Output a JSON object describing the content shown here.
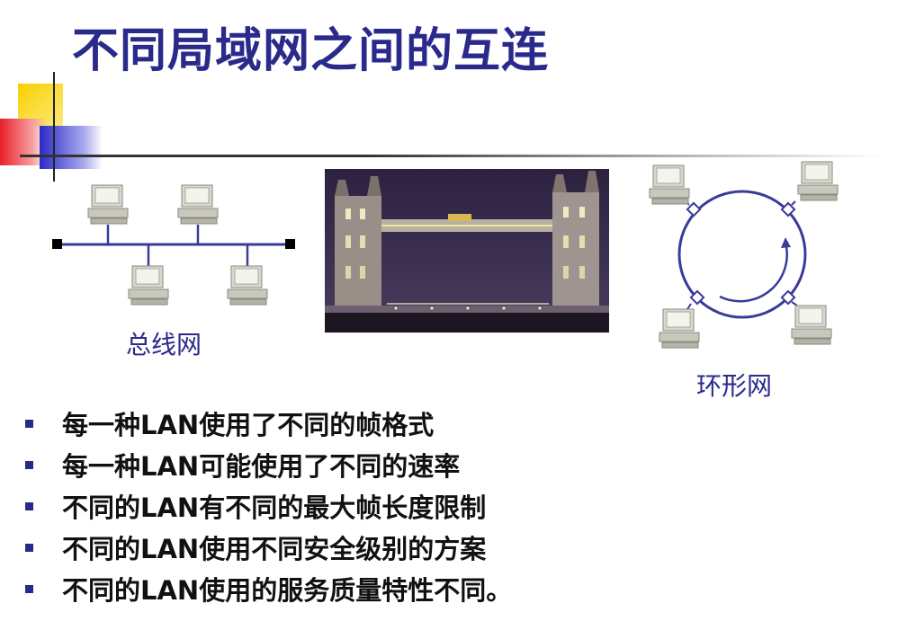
{
  "slide": {
    "title": "不同局域网之间的互连"
  },
  "diagrams": {
    "bus": {
      "label": "总线网",
      "computers": 4
    },
    "ring": {
      "label": "环形网",
      "computers": 4
    },
    "photo": {
      "subject": "tower-bridge-night-photo"
    }
  },
  "bullets": [
    "每一种LAN使用了不同的帧格式",
    "每一种LAN可能使用了不同的速率",
    "不同的LAN有不同的最大帧长度限制",
    "不同的LAN使用不同安全级别的方案",
    "不同的LAN使用的服务质量特性不同。"
  ],
  "colors": {
    "title": "#2a2a8c",
    "accent_yellow": "#f8d000",
    "accent_red": "#e8202a",
    "accent_blue": "#2a2ac8",
    "network_line": "#3a3a9a"
  }
}
